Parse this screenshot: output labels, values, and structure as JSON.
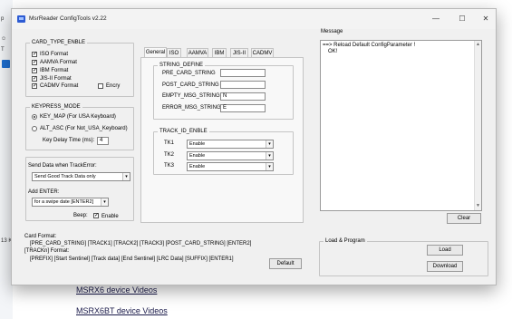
{
  "window": {
    "title": "MsrReader ConfigTools v2.22",
    "minimize": "—",
    "maximize": "☐",
    "close": "✕"
  },
  "background": {
    "edge_items": [
      "p",
      "☺",
      "T",
      "13 K"
    ],
    "links": [
      "MSRX6 device Videos",
      "MSRX6BT device Videos"
    ]
  },
  "card_type": {
    "title": "CARD_TYPE_ENBLE",
    "items": [
      {
        "label": "ISO Format",
        "checked": true
      },
      {
        "label": "AAMVA Format",
        "checked": true
      },
      {
        "label": "IBM Format",
        "checked": true
      },
      {
        "label": "JIS-II Format",
        "checked": true
      },
      {
        "label": "CADMV Format",
        "checked": true
      }
    ],
    "encry_label": "Encry",
    "encry_checked": false
  },
  "keypress": {
    "title": "KEYPRESS_MODE",
    "options": [
      {
        "label": "KEY_MAP (For USA Keyboard)",
        "selected": true
      },
      {
        "label": "ALT_ASC (For Not_USA_Keyboard)",
        "selected": false
      }
    ],
    "delay_label": "Key Delay Time (ms):",
    "delay_value": "4"
  },
  "send_data": {
    "label": "Send Data when TrackError:",
    "value": "Send Good Track Data only",
    "add_enter_label": "Add ENTER:",
    "add_enter_value": "for a swipe date [ENTER2]",
    "beep_label": "Beep:",
    "beep_enable_label": "Enable",
    "beep_checked": true
  },
  "tabs": [
    "General",
    "ISO",
    "AAMVA",
    "IBM",
    "JIS-II",
    "CADMV"
  ],
  "active_tab": "General",
  "string_define": {
    "title": "STRING_DEFINE",
    "fields": [
      {
        "label": "PRE_CARD_STRING",
        "value": ""
      },
      {
        "label": "POST_CARD_STRING",
        "value": ""
      },
      {
        "label": "EMPTY_MSG_STRING",
        "value": "N"
      },
      {
        "label": "ERROR_MSG_STRING",
        "value": "E"
      }
    ]
  },
  "track_id": {
    "title": "TRACK_ID_ENBLE",
    "tracks": [
      {
        "label": "TK1",
        "value": "Enable"
      },
      {
        "label": "TK2",
        "value": "Enable"
      },
      {
        "label": "TK3",
        "value": "Enable"
      }
    ]
  },
  "message": {
    "title": "Message",
    "lines": [
      "==> Reload Default ConfigParameter !",
      "OK!"
    ],
    "clear_label": "Clear"
  },
  "card_format": {
    "label": "Card Format:",
    "line1": "[PRE_CARD_STRING] [TRACK1] [TRACK2] [TRACK3] [POST_CARD_STRING] [ENTER2]",
    "line2": "[TRACKn] Format:",
    "line3": "[PREFIX] [Start Sentinel] [Track data] [End Sentinel] [LRC Data] [SUFFIX] [ENTER1]",
    "default_label": "Default"
  },
  "load_program": {
    "title": "Load & Program",
    "load_label": "Load",
    "download_label": "Download"
  },
  "icons": {
    "checkmark": "✓",
    "dropdown": "▾",
    "scroll_up": "▲",
    "scroll_down": "▼",
    "radio_selected": "●"
  }
}
